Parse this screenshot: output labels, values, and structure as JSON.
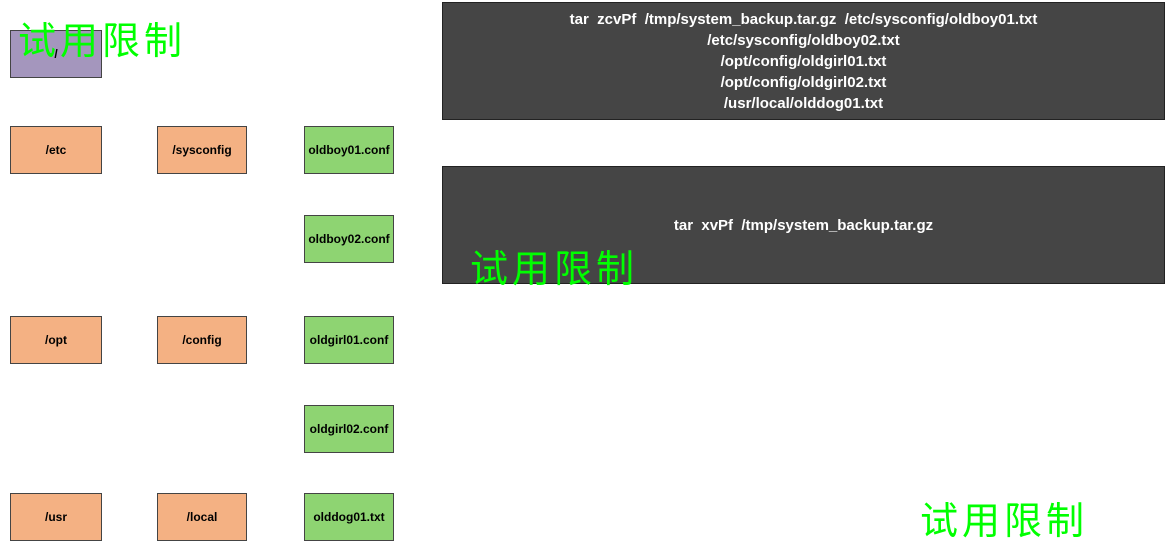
{
  "nodes": {
    "root": "/",
    "etc": "/etc",
    "sysconfig": "/sysconfig",
    "oldboy01": "oldboy01.conf",
    "oldboy02": "oldboy02.conf",
    "opt": "/opt",
    "config": "/config",
    "oldgirl01": "oldgirl01.conf",
    "oldgirl02": "oldgirl02.conf",
    "usr": "/usr",
    "local": "/local",
    "olddog01": "olddog01.txt"
  },
  "codebox1": {
    "line1": "tar  zcvPf  /tmp/system_backup.tar.gz  /etc/sysconfig/oldboy01.txt",
    "line2": "/etc/sysconfig/oldboy02.txt",
    "line3": "/opt/config/oldgirl01.txt",
    "line4": "/opt/config/oldgirl02.txt",
    "line5": "/usr/local/olddog01.txt"
  },
  "codebox2": {
    "line1": "tar  xvPf  /tmp/system_backup.tar.gz"
  },
  "watermark": "试用限制"
}
